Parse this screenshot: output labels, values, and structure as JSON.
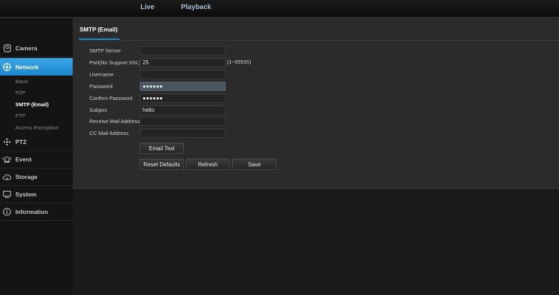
{
  "topnav": {
    "live": "Live",
    "playback": "Playback"
  },
  "sidebar": {
    "sections": {
      "camera": "Camera",
      "network": "Network",
      "ptz": "PTZ",
      "event": "Event",
      "storage": "Storage",
      "system": "System",
      "information": "Information"
    },
    "network_items": [
      "Basic",
      "P2P",
      "SMTP (Email)",
      "FTP",
      "Access Encryption"
    ],
    "active_item": "SMTP (Email)"
  },
  "panel": {
    "tab_title": "SMTP (Email)",
    "fields": {
      "smtp_server": {
        "label": "SMTP Server",
        "value": ""
      },
      "port": {
        "label": "Port(No Support SSL)",
        "value": "25",
        "hint": "(1~65535)"
      },
      "username": {
        "label": "Username",
        "value": ""
      },
      "password": {
        "label": "Password",
        "value": "●●●●●●"
      },
      "confirm_password": {
        "label": "Confirm Password",
        "value": "●●●●●●"
      },
      "subject": {
        "label": "Subject",
        "value": "hello"
      },
      "receive_mail": {
        "label": "Receive Mail Address",
        "value": ""
      },
      "cc_mail": {
        "label": "CC Mail Address",
        "value": ""
      }
    },
    "buttons": {
      "email_test": "Email Test",
      "reset_defaults": "Reset Defaults",
      "refresh": "Refresh",
      "save": "Save"
    }
  },
  "colors": {
    "accent": "#1e88cc",
    "panel_bg": "#2b2b2b",
    "page_bg": "#1b1b1b"
  }
}
